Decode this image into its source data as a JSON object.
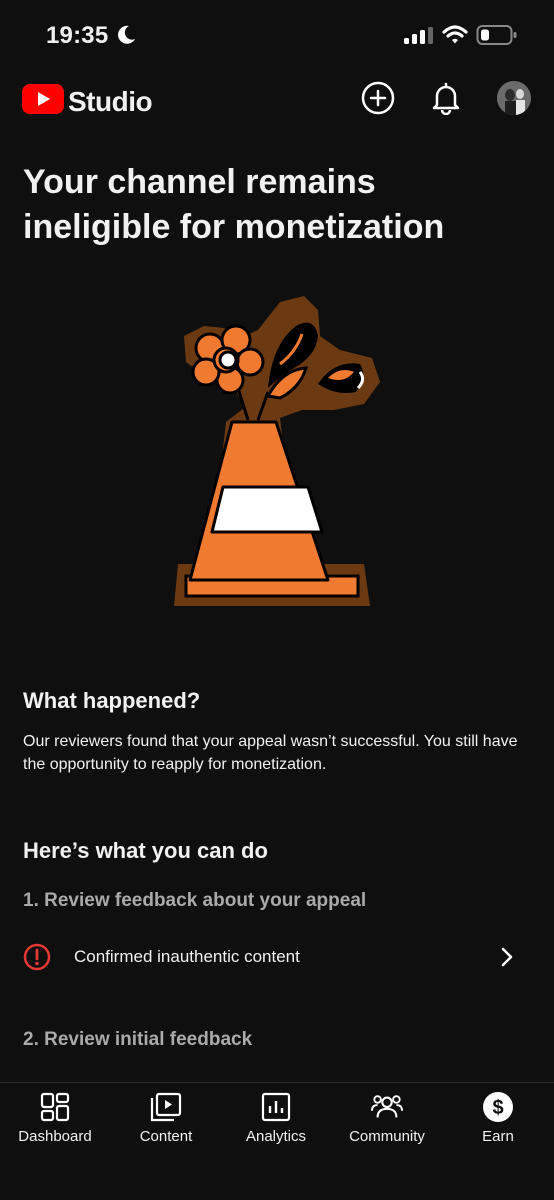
{
  "status_bar": {
    "time": "19:35",
    "icons": [
      "moon-icon",
      "cellular-signal-icon",
      "wifi-icon",
      "battery-icon"
    ]
  },
  "header": {
    "logo_text": "Studio",
    "icons": [
      "youtube-logo-icon",
      "create-plus-icon",
      "notifications-bell-icon",
      "avatar"
    ]
  },
  "main": {
    "title": "Your channel remains ineligible for monetization",
    "illustration": "traffic-cone-with-flower",
    "what_happened": {
      "heading": "What happened?",
      "body": "Our reviewers found that your appeal wasn’t successful. You still have the opportunity to reapply for monetization."
    },
    "what_to_do": {
      "heading": "Here’s what you can do",
      "step1": "1. Review feedback about your appeal",
      "feedback_item": "Confirmed inauthentic content",
      "step2": "2. Review initial feedback"
    }
  },
  "bottom_nav": {
    "items": [
      {
        "label": "Dashboard",
        "icon": "dashboard-grid-icon"
      },
      {
        "label": "Content",
        "icon": "content-play-icon"
      },
      {
        "label": "Analytics",
        "icon": "analytics-bars-icon"
      },
      {
        "label": "Community",
        "icon": "community-people-icon"
      },
      {
        "label": "Earn",
        "icon": "earn-dollar-icon"
      }
    ]
  },
  "colors": {
    "background": "#0f0f0f",
    "brand_red": "#ff0000",
    "alert_red": "#e53935",
    "cone_orange": "#ef7a30",
    "muted_text": "#aaaaaa"
  }
}
